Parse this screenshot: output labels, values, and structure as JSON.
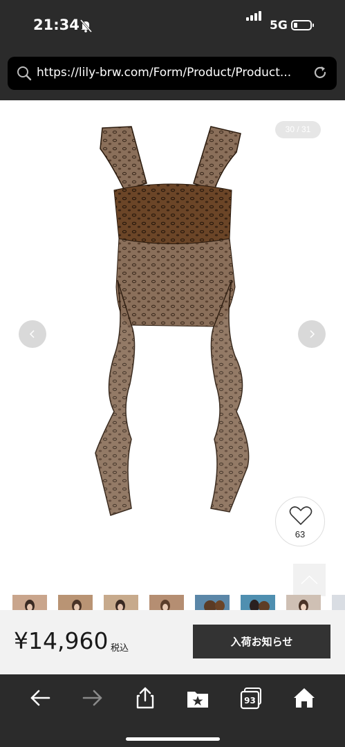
{
  "status_bar": {
    "time": "21:34",
    "network": "5G"
  },
  "browser": {
    "url": "https://lily-brw.com/Form/Product/Product..."
  },
  "gallery": {
    "counter": "30 / 31",
    "favorite_count": "63",
    "thumbnail_colors": [
      "#c9a58c",
      "#b99474",
      "#c7aa8c",
      "#b58e72",
      "#5b87a8",
      "#4f8fb0",
      "#cfc0b4",
      "#d9dde3"
    ]
  },
  "purchase": {
    "price": "¥14,960",
    "tax_label": "税込",
    "notify_button": "入荷お知らせ"
  },
  "toolbar": {
    "tabs_count": "93"
  },
  "colors": {
    "chrome": "#2b2b2b",
    "button": "#333333",
    "pricebar": "#f2f2f2"
  }
}
